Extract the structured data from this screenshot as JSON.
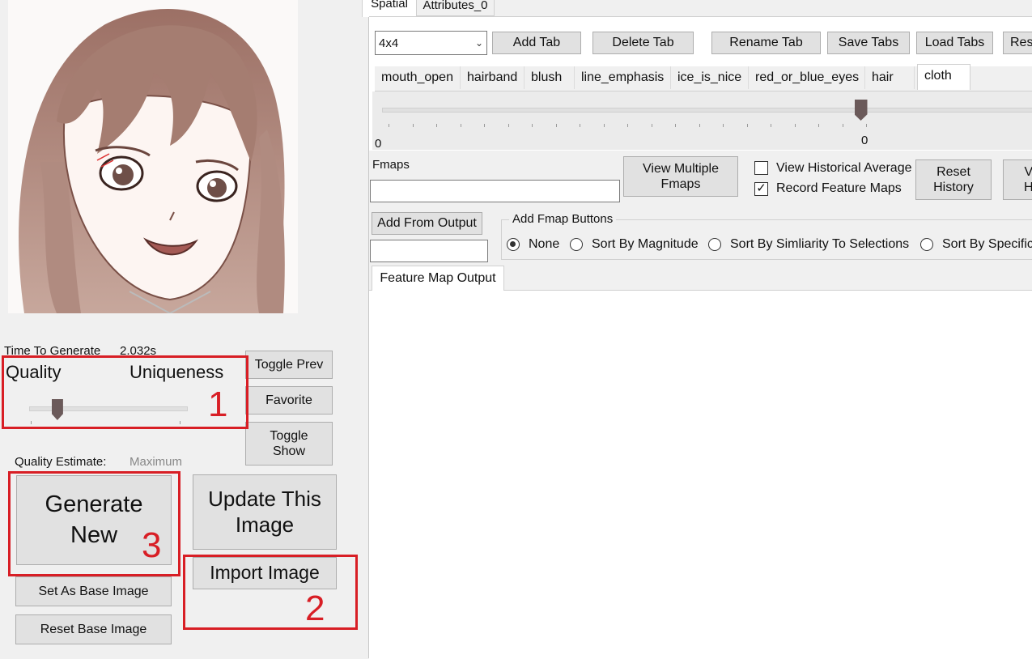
{
  "top_tabs": [
    "Spatial",
    "Attributes_0"
  ],
  "left": {
    "time_label": "Time To Generate",
    "time_value": "2.032s",
    "quality_label": "Quality",
    "uniqueness_label": "Uniqueness",
    "quality_slider_value": 0.18,
    "toggle_prev": "Toggle Prev",
    "favorite": "Favorite",
    "toggle_show": "Toggle Show",
    "quality_estimate_label": "Quality Estimate:",
    "quality_estimate_value": "Maximum",
    "generate_new": "Generate New",
    "update_image": "Update This Image",
    "import_image": "Import Image",
    "set_base": "Set As Base Image",
    "reset_base": "Reset Base Image",
    "annotations": [
      "1",
      "2",
      "3"
    ]
  },
  "right": {
    "dropdown_value": "4x4",
    "add_tab": "Add Tab",
    "delete_tab": "Delete Tab",
    "rename_tab": "Rename Tab",
    "save_tabs": "Save Tabs",
    "load_tabs": "Load Tabs",
    "res_button": "Res",
    "attr_tabs": [
      "mouth_open",
      "hairband",
      "blush",
      "line_emphasis",
      "ice_is_nice",
      "red_or_blue_eyes",
      "hair",
      "cloth"
    ],
    "active_attr_tab": "cloth",
    "slider_min_label": "0",
    "slider_value_label": "0",
    "slider_value": 0.5,
    "fmaps_label": "Fmaps",
    "fmaps_value": "",
    "view_multiple": "View Multiple Fmaps",
    "view_hist_avg": "View Historical Average",
    "view_hist_avg_checked": false,
    "record_fmaps": "Record Feature Maps",
    "record_fmaps_checked": true,
    "reset_history": "Reset History",
    "view_h_partial": "V H",
    "add_from_output": "Add From Output",
    "add_fmap_buttons": "Add Fmap Buttons",
    "radio_options": [
      "None",
      "Sort By Magnitude",
      "Sort By Simliarity To Selections",
      "Sort By Specific"
    ],
    "radio_selected": "None",
    "feature_map_tab": "Feature Map Output"
  }
}
